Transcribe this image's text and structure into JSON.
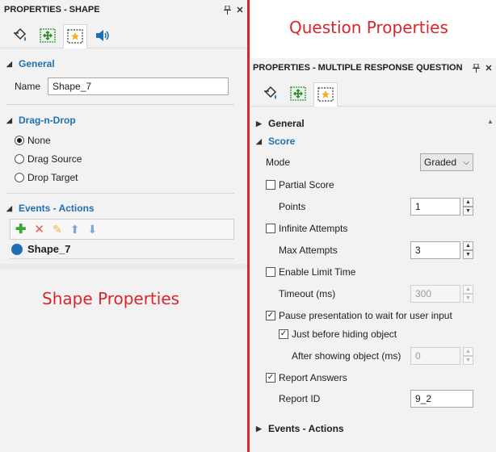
{
  "shape_panel": {
    "title": "PROPERTIES - SHAPE",
    "pin_icon": "pin-icon",
    "close_icon": "close-icon",
    "tabs": [
      "paint-bucket-icon",
      "move-icon",
      "star-frame-icon",
      "audio-icon"
    ],
    "general_header": "General",
    "name_label": "Name",
    "name_value": "Shape_7",
    "dragdrop_header": "Drag-n-Drop",
    "drag_options": [
      "None",
      "Drag Source",
      "Drop Target"
    ],
    "drag_selected": "None",
    "events_header": "Events - Actions",
    "event_toolbar": [
      "add-icon",
      "delete-icon",
      "edit-icon",
      "move-up-icon",
      "move-down-icon"
    ],
    "event_item": "Shape_7",
    "annotation": "Shape Properties"
  },
  "question_panel": {
    "annotation": "Question Properties",
    "title": "PROPERTIES - MULTIPLE RESPONSE QUESTION",
    "tabs": [
      "paint-bucket-icon",
      "move-icon",
      "star-frame-icon"
    ],
    "general_header": "General",
    "score_header": "Score",
    "mode_label": "Mode",
    "mode_value": "Graded",
    "partial_score_label": "Partial Score",
    "partial_score_checked": false,
    "points_label": "Points",
    "points_value": "1",
    "infinite_attempts_label": "Infinite Attempts",
    "infinite_attempts_checked": false,
    "max_attempts_label": "Max Attempts",
    "max_attempts_value": "3",
    "enable_limit_label": "Enable Limit Time",
    "enable_limit_checked": false,
    "timeout_label": "Timeout (ms)",
    "timeout_value": "300",
    "pause_label": "Pause presentation to wait for user input",
    "pause_checked": true,
    "before_hiding_label": "Just before hiding object",
    "before_hiding_checked": true,
    "after_showing_label": "After showing object (ms)",
    "after_showing_value": "0",
    "report_answers_label": "Report Answers",
    "report_answers_checked": true,
    "report_id_label": "Report ID",
    "report_id_value": "9_2",
    "events_header": "Events - Actions"
  },
  "colors": {
    "accent_blue": "#1f6fb4",
    "annotation_red": "#d8262b",
    "panel_bg": "#f2f2f2"
  }
}
